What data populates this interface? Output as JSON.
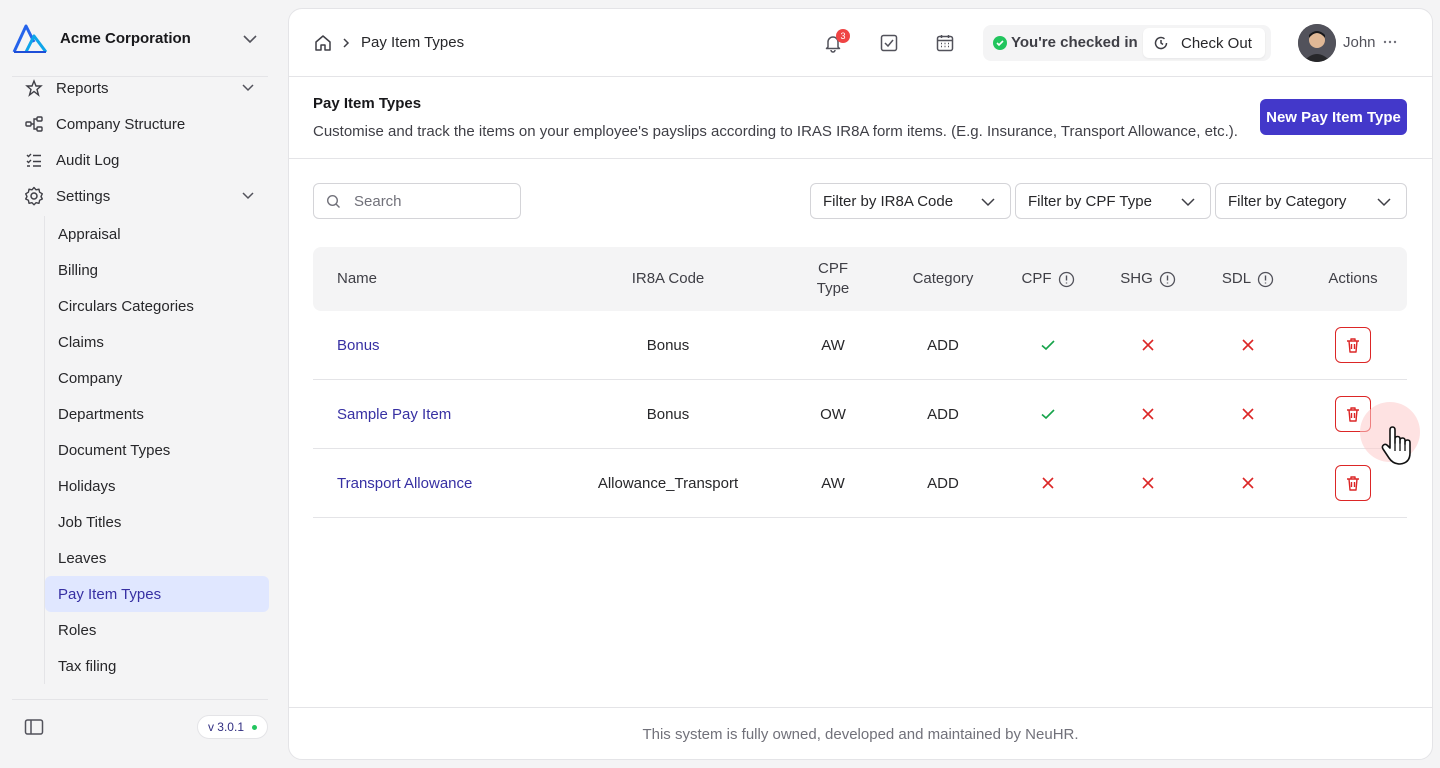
{
  "org": {
    "name": "Acme Corporation"
  },
  "sidebar": {
    "items": [
      {
        "label": "Reports",
        "icon": "star-icon"
      },
      {
        "label": "Company Structure",
        "icon": "hierarchy-icon"
      },
      {
        "label": "Audit Log",
        "icon": "checklist-icon"
      },
      {
        "label": "Settings",
        "icon": "gear-icon"
      }
    ],
    "settings_children": [
      "Appraisal",
      "Billing",
      "Circulars Categories",
      "Claims",
      "Company",
      "Departments",
      "Document Types",
      "Holidays",
      "Job Titles",
      "Leaves",
      "Pay Item Types",
      "Roles",
      "Tax filing"
    ],
    "active_child": "Pay Item Types",
    "version": "v 3.0.1"
  },
  "topbar": {
    "breadcrumb_current": "Pay Item Types",
    "notification_count": "3",
    "checkin_status": "You're checked in",
    "checkout_label": "Check Out",
    "user_name": "John"
  },
  "header": {
    "title": "Pay Item Types",
    "description": "Customise and track the items on your employee's payslips according to IRAS IR8A form items. (E.g. Insurance, Transport Allowance, etc.).",
    "new_button": "New Pay Item Type"
  },
  "filters": {
    "search_placeholder": "Search",
    "ir8a": "Filter by IR8A Code",
    "cpf": "Filter by CPF Type",
    "category": "Filter by Category"
  },
  "table": {
    "columns": {
      "name": "Name",
      "ir8a": "IR8A Code",
      "cpf_type": "CPF Type",
      "category": "Category",
      "cpf": "CPF",
      "shg": "SHG",
      "sdl": "SDL",
      "actions": "Actions"
    },
    "rows": [
      {
        "name": "Bonus",
        "ir8a": "Bonus",
        "cpf_type": "AW",
        "category": "ADD",
        "cpf": true,
        "shg": false,
        "sdl": false
      },
      {
        "name": "Sample Pay Item",
        "ir8a": "Bonus",
        "cpf_type": "OW",
        "category": "ADD",
        "cpf": true,
        "shg": false,
        "sdl": false
      },
      {
        "name": "Transport Allowance",
        "ir8a": "Allowance_Transport",
        "cpf_type": "AW",
        "category": "ADD",
        "cpf": false,
        "shg": false,
        "sdl": false
      }
    ]
  },
  "footer": {
    "text": "This system is fully owned, developed and maintained by NeuHR."
  },
  "colors": {
    "primary": "#4338ca",
    "link": "#3730a3",
    "success": "#16a34a",
    "danger": "#dc2626",
    "active_bg": "#e0e7ff"
  }
}
